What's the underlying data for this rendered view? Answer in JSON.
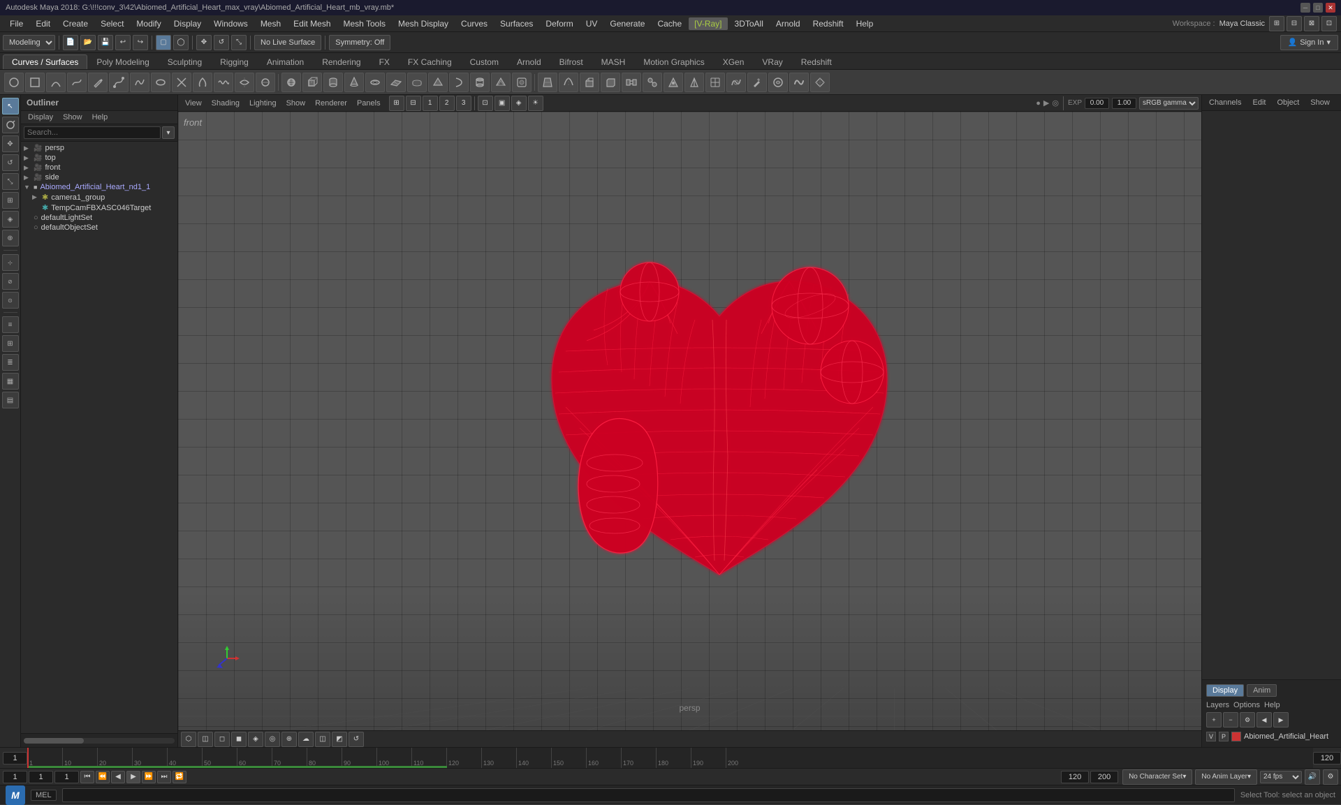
{
  "title_bar": {
    "title": "Autodesk Maya 2018: G:\\!!!conv_3\\42\\Abiomed_Artificial_Heart_max_vray\\Abiomed_Artificial_Heart_mb_vray.mb*",
    "minimize": "─",
    "maximize": "□",
    "close": "✕"
  },
  "menu": {
    "items": [
      "File",
      "Edit",
      "Create",
      "Select",
      "Modify",
      "Display",
      "Windows",
      "Mesh",
      "Edit Mesh",
      "Mesh Tools",
      "Mesh Display",
      "Curves",
      "Surfaces",
      "Deform",
      "UV",
      "Generate",
      "Cache",
      "[V-Ray]",
      "3DToAll",
      "Arnold",
      "Redshift",
      "Help"
    ]
  },
  "toolbar": {
    "workspace_label": "Workspace :",
    "workspace_value": "Maya Classic",
    "modeling_dropdown": "Modeling",
    "live_surface": "No Live Surface",
    "symmetry": "Symmetry: Off",
    "sign_in": "Sign In"
  },
  "shelf": {
    "tabs": [
      "Curves / Surfaces",
      "Poly Modeling",
      "Sculpting",
      "Rigging",
      "Animation",
      "Rendering",
      "FX",
      "FX Caching",
      "Custom",
      "Arnold",
      "Bifrost",
      "MASH",
      "Motion Graphics",
      "XGen",
      "VRay",
      "Redshift"
    ],
    "active_tab": "Curves / Surfaces"
  },
  "viewport": {
    "menu": [
      "View",
      "Shading",
      "Lighting",
      "Show",
      "Renderer",
      "Panels"
    ],
    "camera": "front",
    "persp_label": "persp",
    "gamma_label": "sRGB gamma",
    "value1": "0.00",
    "value2": "1.00"
  },
  "outliner": {
    "title": "Outliner",
    "menu": [
      "Display",
      "Show",
      "Help"
    ],
    "search_placeholder": "Search...",
    "tree_items": [
      {
        "label": "persp",
        "type": "camera",
        "depth": 1
      },
      {
        "label": "top",
        "type": "camera",
        "depth": 1
      },
      {
        "label": "front",
        "type": "camera",
        "depth": 1
      },
      {
        "label": "side",
        "type": "camera",
        "depth": 1
      },
      {
        "label": "Abiomed_Artificial_Heart_nd1_1",
        "type": "group",
        "depth": 1
      },
      {
        "label": "camera1_group",
        "type": "group",
        "depth": 2
      },
      {
        "label": "TempCamFBXASC046Target",
        "type": "target",
        "depth": 2
      },
      {
        "label": "defaultLightSet",
        "type": "set",
        "depth": 1
      },
      {
        "label": "defaultObjectSet",
        "type": "set",
        "depth": 1
      }
    ]
  },
  "channel_box": {
    "header_tabs": [
      "Channels",
      "Edit",
      "Object",
      "Show"
    ],
    "display_tabs": [
      "Display",
      "Anim"
    ],
    "active_display_tab": "Display",
    "layer_options": [
      "Layers",
      "Options",
      "Help"
    ],
    "layers": [
      {
        "v": "V",
        "p": "P",
        "color": "#cc3333",
        "name": "Abiomed_Artificial_Heart"
      }
    ]
  },
  "timeline": {
    "start": "1",
    "end": "120",
    "range_start": "1",
    "range_end": "120",
    "max_range": "200",
    "ticks": [
      "1",
      "10",
      "20",
      "30",
      "40",
      "50",
      "60",
      "70",
      "80",
      "90",
      "100",
      "110",
      "120",
      "130",
      "140",
      "150",
      "160",
      "170",
      "180",
      "190",
      "200"
    ]
  },
  "transport": {
    "current_frame_label": "1",
    "end_frame_label": "1",
    "no_character": "No Character Set",
    "no_anim": "No Anim Layer",
    "fps": "24 fps"
  },
  "status_bar": {
    "mel_label": "MEL",
    "status_text": "Select Tool: select an object",
    "maya_logo": "M"
  },
  "left_toolbar": {
    "buttons": [
      "↖",
      "↗",
      "✥",
      "⟳",
      "⬡",
      "▣",
      "◈",
      "⊕",
      "⊘",
      "⊙",
      "≡",
      "⊞",
      "≣",
      "▦",
      "▤"
    ]
  }
}
